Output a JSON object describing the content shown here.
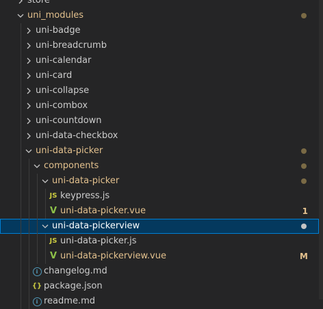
{
  "tree": [
    {
      "label": "store",
      "depth": 0,
      "type": "folder",
      "expanded": false,
      "status": "normal"
    },
    {
      "label": "uni_modules",
      "depth": 0,
      "type": "folder",
      "expanded": true,
      "status": "modified",
      "dot": true
    },
    {
      "label": "uni-badge",
      "depth": 1,
      "type": "folder",
      "expanded": false,
      "status": "normal"
    },
    {
      "label": "uni-breadcrumb",
      "depth": 1,
      "type": "folder",
      "expanded": false,
      "status": "normal"
    },
    {
      "label": "uni-calendar",
      "depth": 1,
      "type": "folder",
      "expanded": false,
      "status": "normal"
    },
    {
      "label": "uni-card",
      "depth": 1,
      "type": "folder",
      "expanded": false,
      "status": "normal"
    },
    {
      "label": "uni-collapse",
      "depth": 1,
      "type": "folder",
      "expanded": false,
      "status": "normal"
    },
    {
      "label": "uni-combox",
      "depth": 1,
      "type": "folder",
      "expanded": false,
      "status": "normal"
    },
    {
      "label": "uni-countdown",
      "depth": 1,
      "type": "folder",
      "expanded": false,
      "status": "normal"
    },
    {
      "label": "uni-data-checkbox",
      "depth": 1,
      "type": "folder",
      "expanded": false,
      "status": "normal"
    },
    {
      "label": "uni-data-picker",
      "depth": 1,
      "type": "folder",
      "expanded": true,
      "status": "modified",
      "dot": true
    },
    {
      "label": "components",
      "depth": 2,
      "type": "folder",
      "expanded": true,
      "status": "modified",
      "dot": true
    },
    {
      "label": "uni-data-picker",
      "depth": 3,
      "type": "folder",
      "expanded": true,
      "status": "modified",
      "dot": true
    },
    {
      "label": "keypress.js",
      "depth": 4,
      "type": "js",
      "status": "normal"
    },
    {
      "label": "uni-data-picker.vue",
      "depth": 4,
      "type": "vue",
      "status": "modified",
      "badge": "1"
    },
    {
      "label": "uni-data-pickerview",
      "depth": 3,
      "type": "folder",
      "expanded": true,
      "status": "selected",
      "dot": true,
      "selected": true
    },
    {
      "label": "uni-data-picker.js",
      "depth": 4,
      "type": "js",
      "status": "normal"
    },
    {
      "label": "uni-data-pickerview.vue",
      "depth": 4,
      "type": "vue",
      "status": "modified",
      "badge": "M"
    },
    {
      "label": "changelog.md",
      "depth": 2,
      "type": "info",
      "status": "normal"
    },
    {
      "label": "package.json",
      "depth": 2,
      "type": "json",
      "status": "normal"
    },
    {
      "label": "readme.md",
      "depth": 2,
      "type": "info",
      "status": "normal"
    }
  ],
  "icons": {
    "js": "JS",
    "json": "{}",
    "vue": "V",
    "info": "i"
  },
  "colors": {
    "background": "#252526",
    "modified": "#e2c08d",
    "selected_bg": "#04395e",
    "selected_border": "#007fd4",
    "js": "#cbcb41",
    "json": "#cbcb41",
    "vue": "#8dc149",
    "info": "#519aba"
  }
}
